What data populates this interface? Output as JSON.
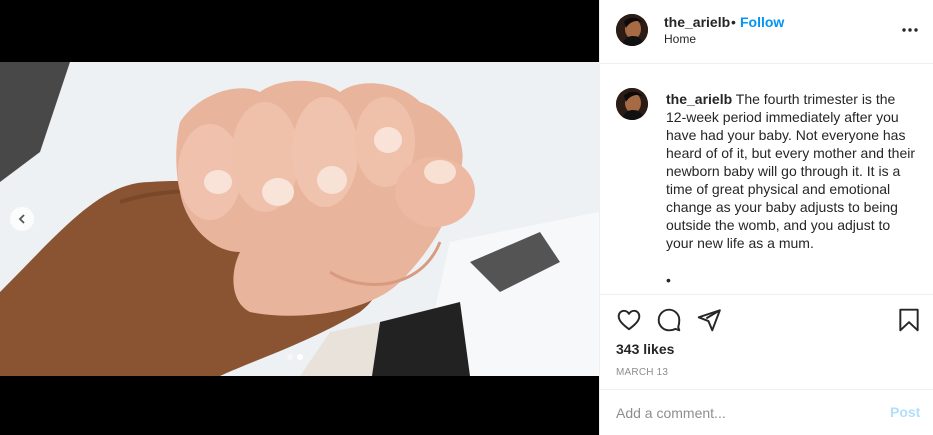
{
  "post": {
    "username": "the_arielb",
    "follow_label": "Follow",
    "separator": "•",
    "location": "Home",
    "caption": "The fourth trimester is the 12-week period immediately after you have had your baby. Not everyone has heard of of it, but every mother and their newborn baby will go through it. It is a time of great physical and emotional change as your baby adjusts to being outside the womb, and you adjust to your new life as a mum.",
    "caption_bullet": "•",
    "likes": "343 likes",
    "date": "MARCH 13"
  },
  "comment": {
    "placeholder": "Add a comment...",
    "post_label": "Post"
  },
  "carousel": {
    "slide_count": 2,
    "active_index": 1
  },
  "icons": {
    "more": "more-options-icon",
    "like": "heart-icon",
    "comment": "comment-icon",
    "share": "share-icon",
    "save": "bookmark-icon",
    "prev": "chevron-left-icon"
  },
  "colors": {
    "accent": "#0095f6",
    "post_disabled": "#b2dffc",
    "secondary_text": "#8e8e8e"
  }
}
